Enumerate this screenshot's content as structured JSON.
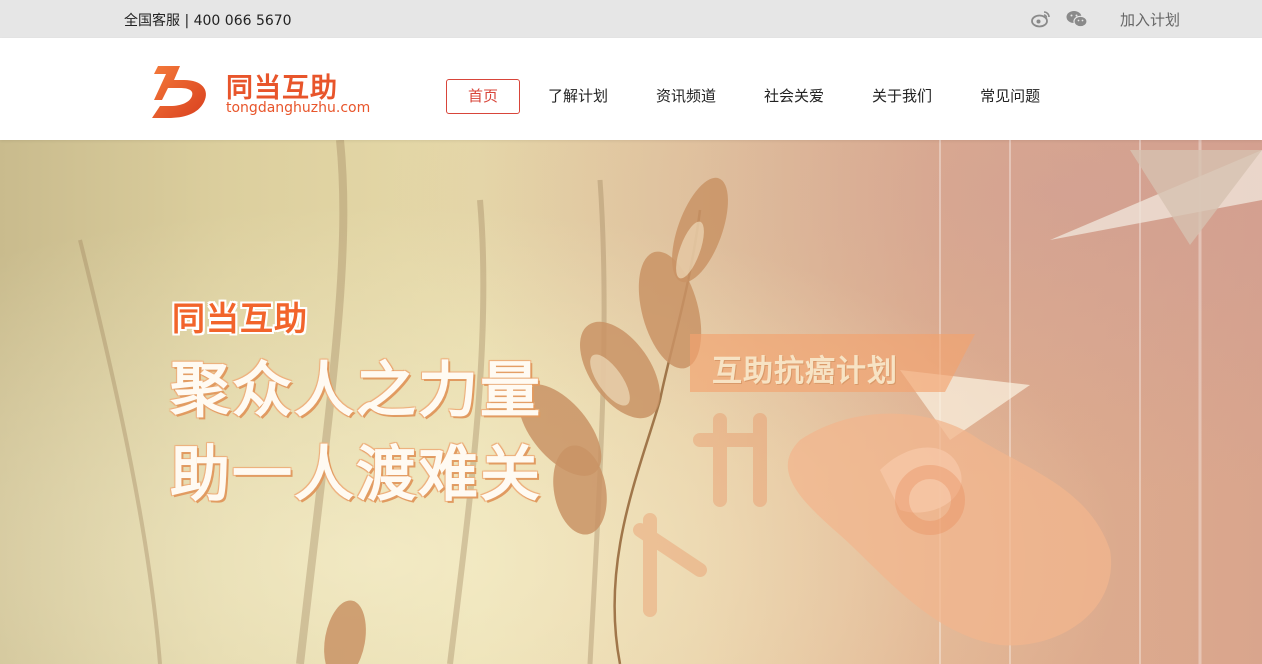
{
  "topbar": {
    "hotline": "全国客服 | 400 066 5670",
    "icons": [
      "weibo-icon",
      "wechat-icon"
    ],
    "join_label": "加入计划"
  },
  "logo": {
    "name": "同当互助",
    "url_text": "tongdanghuzhu.com",
    "color": "#e8552b"
  },
  "nav": {
    "items": [
      {
        "label": "首页",
        "active": true
      },
      {
        "label": "了解计划",
        "active": false
      },
      {
        "label": "资讯频道",
        "active": false
      },
      {
        "label": "社会关爱",
        "active": false
      },
      {
        "label": "关于我们",
        "active": false
      },
      {
        "label": "常见问题",
        "active": false
      }
    ],
    "active_color": "#d8453a"
  },
  "banner": {
    "brand": "同当互助",
    "slogan_line1": "聚众人之力量",
    "slogan_line2": "助一人渡难关",
    "plan_label": "互助抗癌计划"
  }
}
